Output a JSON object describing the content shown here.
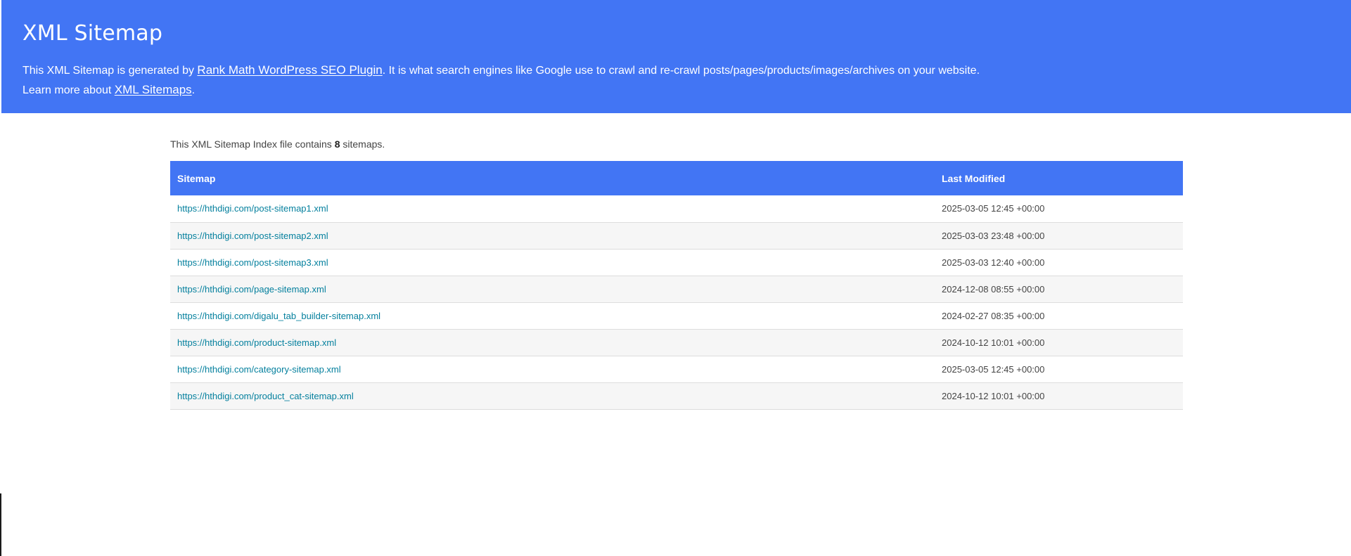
{
  "header": {
    "title": "XML Sitemap",
    "desc_part1": "This XML Sitemap is generated by ",
    "plugin_link": "Rank Math WordPress SEO Plugin",
    "desc_part2": ". It is what search engines like Google use to crawl and re-crawl posts/pages/products/images/archives on your website.",
    "learn_prefix": "Learn more about ",
    "learn_link": "XML Sitemaps",
    "learn_suffix": "."
  },
  "summary": {
    "prefix": "This XML Sitemap Index file contains ",
    "count": "8",
    "suffix": " sitemaps."
  },
  "table": {
    "columns": [
      "Sitemap",
      "Last Modified"
    ],
    "rows": [
      {
        "url": "https://hthdigi.com/post-sitemap1.xml",
        "modified": "2025-03-05 12:45 +00:00"
      },
      {
        "url": "https://hthdigi.com/post-sitemap2.xml",
        "modified": "2025-03-03 23:48 +00:00"
      },
      {
        "url": "https://hthdigi.com/post-sitemap3.xml",
        "modified": "2025-03-03 12:40 +00:00"
      },
      {
        "url": "https://hthdigi.com/page-sitemap.xml",
        "modified": "2024-12-08 08:55 +00:00"
      },
      {
        "url": "https://hthdigi.com/digalu_tab_builder-sitemap.xml",
        "modified": "2024-02-27 08:35 +00:00"
      },
      {
        "url": "https://hthdigi.com/product-sitemap.xml",
        "modified": "2024-10-12 10:01 +00:00"
      },
      {
        "url": "https://hthdigi.com/category-sitemap.xml",
        "modified": "2025-03-05 12:45 +00:00"
      },
      {
        "url": "https://hthdigi.com/product_cat-sitemap.xml",
        "modified": "2024-10-12 10:01 +00:00"
      }
    ]
  },
  "colors": {
    "header_bg": "#4275f4",
    "link": "#05809e",
    "row_alt": "#f6f6f6"
  }
}
